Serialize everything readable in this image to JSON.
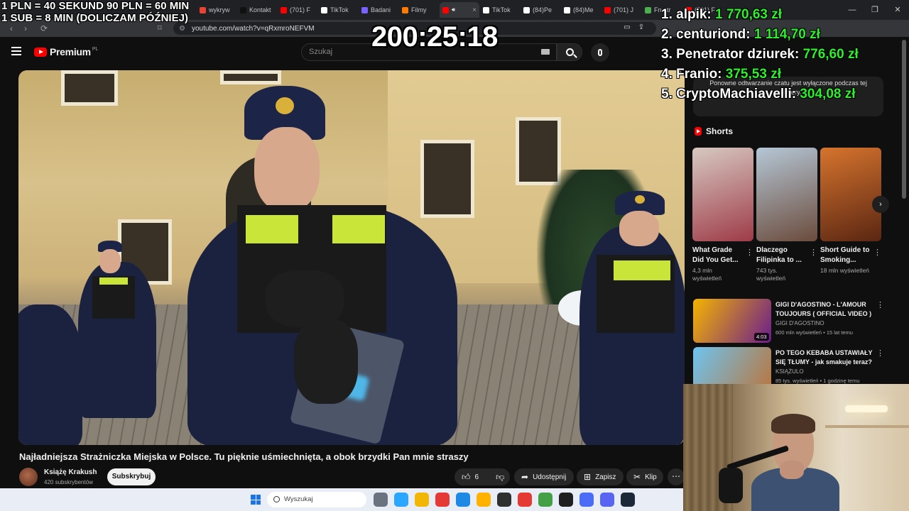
{
  "browser": {
    "tabs": [
      {
        "label": "wykryw",
        "color": "#ea4335"
      },
      {
        "label": "Kontakt",
        "color": "#111111"
      },
      {
        "label": "(701) F",
        "color": "#ff0000"
      },
      {
        "label": "TikTok",
        "color": "#ffffff"
      },
      {
        "label": "Badani",
        "color": "#7b61ff"
      },
      {
        "label": "Filmy",
        "color": "#ff7a00"
      },
      {
        "label": "",
        "color": "#ff0000",
        "active": true
      },
      {
        "label": "TikTok",
        "color": "#ffffff"
      },
      {
        "label": "(84)Pe",
        "color": "#ffffff"
      },
      {
        "label": "(84)Me",
        "color": "#ffffff"
      },
      {
        "label": "(701) J",
        "color": "#ff0000"
      },
      {
        "label": "Frustr",
        "color": "#4caf50"
      },
      {
        "label": "(701) F",
        "color": "#ff0000"
      }
    ],
    "url": "youtube.com/watch?v=qRxmroNEFVM"
  },
  "youtube": {
    "logo": "Premium",
    "logo_region": "PL",
    "search_placeholder": "Szukaj",
    "video_title": "Najładniejsza Strażniczka Miejska w Polsce. Tu pięknie uśmiechnięta, a obok brzydki Pan mnie straszy",
    "channel_name": "Książę Krakush",
    "channel_subs": "420 subskrybentów",
    "subscribe_label": "Subskrybuj",
    "likes": "6",
    "share_label": "Udostępnij",
    "save_label": "Zapisz",
    "clip_label": "Klip"
  },
  "sidebar": {
    "chat_notice": "Ponowne odtwarzanie czatu jest wyłączone podczas tej premiery.",
    "shorts_title": "Shorts",
    "shorts": [
      {
        "title": "What Grade Did You Get...",
        "views": "4,3 mln wyświetleń",
        "thumb": [
          "#d7c9c1",
          "#9e3b48"
        ]
      },
      {
        "title": "Dlaczego Filipinka to ...",
        "views": "743 tys. wyświetleń",
        "thumb": [
          "#b5c7d6",
          "#6b4b3c"
        ]
      },
      {
        "title": "Short Guide to Smoking...",
        "views": "18 mln wyświetleń",
        "thumb": [
          "#d6742e",
          "#5a2612"
        ]
      }
    ],
    "recommended": [
      {
        "title": "GIGI D'AGOSTINO - L'AMOUR TOUJOURS ( OFFICIAL VIDEO )",
        "channel": "GIGI D'AGOSTINO",
        "meta": "600 mln wyświetleń • 15 lat temu",
        "duration": "4:03",
        "thumb": [
          "#f5b400",
          "#6b1d8c"
        ]
      },
      {
        "title": "PO TEGO KEBABA USTAWIAŁY SIĘ TŁUMY - jak smakuje teraz?",
        "channel": "KSIĄŻULO",
        "meta": "85 tys. wyświetleń • 1 godzinę temu",
        "duration": "",
        "thumb": [
          "#6ec4f0",
          "#b9763e"
        ]
      }
    ]
  },
  "taskbar": {
    "search_placeholder": "Wyszukaj",
    "icons": [
      "#6b7280",
      "#2aa6ff",
      "#f2b705",
      "#e53935",
      "#1e88e5",
      "#ffb300",
      "#2f2f2f",
      "#e53935",
      "#43a047",
      "#1f1f1f",
      "#4a6cf7",
      "#5865f2",
      "#1b2838"
    ]
  },
  "overlay": {
    "rate_line_1": "1 PLN =  40 SEKUND 90 PLN = 60 MIN",
    "rate_line_2": "1 SUB = 8 MIN (DOLICZAM PÓŹNIEJ)",
    "timer": "200:25:18",
    "donors": [
      {
        "name": "1. alpik:",
        "amount": "1 770,63 zł"
      },
      {
        "name": "2. centuriond:",
        "amount": "1 114,70 zł"
      },
      {
        "name": "3. Penetrator dziurek:",
        "amount": "776,60 zł"
      },
      {
        "name": "4. Franio:",
        "amount": "375,53 zł"
      },
      {
        "name": "5. CryptoMachiavelli:",
        "amount": "304,08 zł"
      }
    ]
  }
}
